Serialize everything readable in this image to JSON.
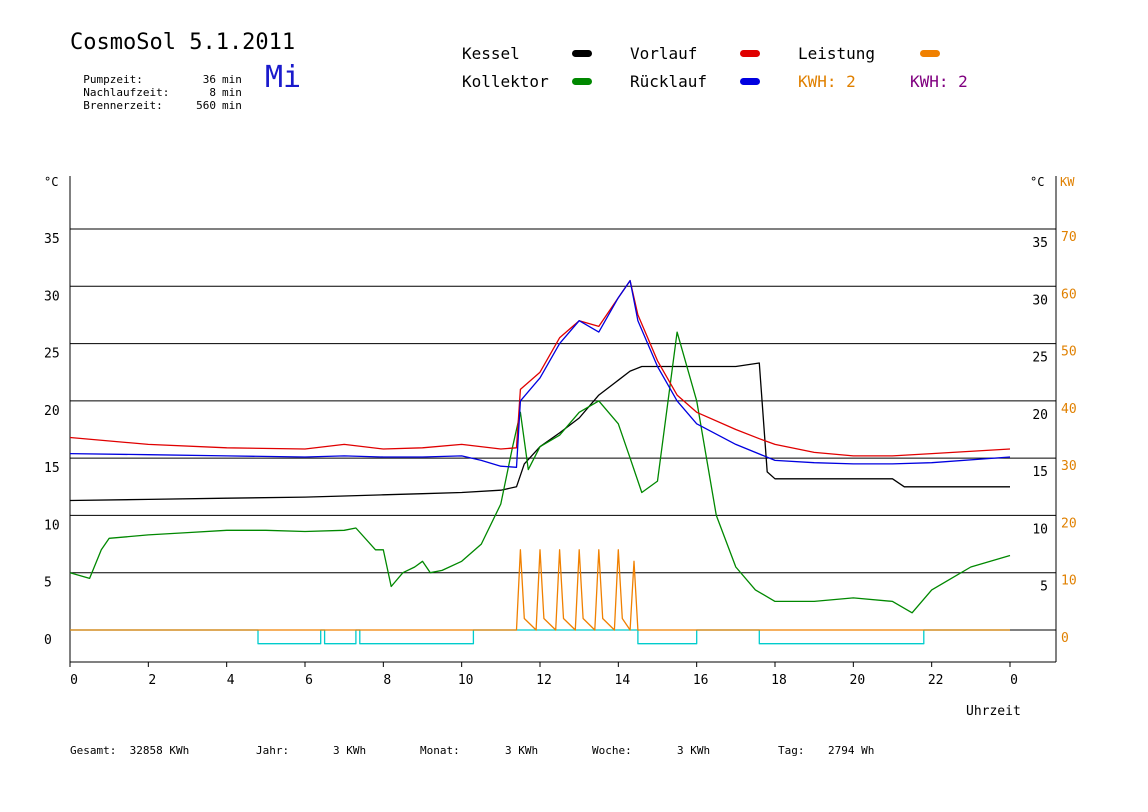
{
  "header": {
    "title": "CosmoSol 5.1.2011",
    "weekday": "Mi",
    "stats": [
      {
        "label": "Pumpzeit:",
        "value": "36",
        "unit": "min"
      },
      {
        "label": "Nachlaufzeit:",
        "value": "8",
        "unit": "min"
      },
      {
        "label": "Brennerzeit:",
        "value": "560",
        "unit": "min"
      }
    ]
  },
  "legend": {
    "kessel": "Kessel",
    "kollektor": "Kollektor",
    "vorlauf": "Vorlauf",
    "ruecklauf": "Rücklauf",
    "leistung": "Leistung",
    "kwh_orange": "KWH: 2",
    "kwh_purple": "KWH: 2",
    "colors": {
      "kessel": "#000000",
      "kollektor": "#008800",
      "vorlauf": "#e00000",
      "ruecklauf": "#0000e0",
      "leistung": "#f08000",
      "kwh_purple": "#800080",
      "pump": "#00cccc"
    }
  },
  "footer": {
    "gesamt_label": "Gesamt:",
    "gesamt_value": "32858 KWh",
    "jahr_label": "Jahr:",
    "jahr_value": "3 KWh",
    "monat_label": "Monat:",
    "monat_value": "3 KWh",
    "woche_label": "Woche:",
    "woche_value": "3 KWh",
    "tag_label": "Tag:",
    "tag_value": "2794 Wh"
  },
  "chart_data": {
    "type": "line",
    "title": "CosmoSol 5.1.2011",
    "xlabel": "Uhrzeit",
    "ylabel_left": "°C",
    "ylabel_right_1": "°C",
    "ylabel_right_2": "KW",
    "xlim": [
      0,
      24
    ],
    "ylim": [
      0,
      40
    ],
    "ylim_kw": [
      0,
      80
    ],
    "x_ticks": [
      "0",
      "2",
      "4",
      "6",
      "8",
      "10",
      "12",
      "14",
      "16",
      "18",
      "20",
      "22",
      "0"
    ],
    "y_ticks_left": [
      "0",
      "5",
      "10",
      "15",
      "20",
      "25",
      "30",
      "35"
    ],
    "y_ticks_right_c": [
      "5",
      "10",
      "15",
      "20",
      "25",
      "30",
      "35"
    ],
    "y_ticks_right_kw": [
      "0",
      "10",
      "20",
      "30",
      "40",
      "50",
      "60",
      "70"
    ],
    "grid": "horizontal",
    "series": [
      {
        "name": "Kessel",
        "color": "#000000",
        "x": [
          0,
          2,
          4,
          6,
          7,
          8,
          9,
          10,
          11,
          11.4,
          11.6,
          12,
          12.5,
          13,
          13.5,
          14,
          14.3,
          14.6,
          15,
          16,
          17,
          17.6,
          17.8,
          18,
          19,
          20,
          21,
          21.3,
          22,
          24
        ],
        "y": [
          11.3,
          11.4,
          11.5,
          11.6,
          11.7,
          11.8,
          11.9,
          12.0,
          12.2,
          12.5,
          14.5,
          16,
          17.2,
          18.5,
          20.5,
          21.8,
          22.6,
          23,
          23,
          23,
          23,
          23.3,
          13.8,
          13.2,
          13.2,
          13.2,
          13.2,
          12.5,
          12.5,
          12.5
        ]
      },
      {
        "name": "Vorlauf",
        "color": "#e00000",
        "x": [
          0,
          2,
          4,
          6,
          7,
          8,
          9,
          10,
          11,
          11.4,
          11.5,
          12,
          12.5,
          13,
          13.5,
          14,
          14.3,
          14.5,
          15,
          15.5,
          16,
          17,
          17.6,
          18,
          19,
          20,
          21,
          22,
          24
        ],
        "y": [
          16.8,
          16.2,
          15.9,
          15.8,
          16.2,
          15.8,
          15.9,
          16.2,
          15.8,
          15.9,
          21,
          22.5,
          25.5,
          27,
          26.5,
          29,
          30.5,
          27.5,
          23.5,
          20.5,
          19,
          17.5,
          16.7,
          16.2,
          15.5,
          15.2,
          15.2,
          15.4,
          15.8
        ]
      },
      {
        "name": "Rücklauf",
        "color": "#0000e0",
        "x": [
          0,
          2,
          4,
          6,
          7,
          8,
          9,
          10,
          10.5,
          11,
          11.4,
          11.5,
          12,
          12.5,
          13,
          13.5,
          14,
          14.3,
          14.5,
          15,
          15.5,
          16,
          17,
          18,
          19,
          20,
          21,
          22,
          24
        ],
        "y": [
          15.4,
          15.3,
          15.2,
          15.1,
          15.2,
          15.1,
          15.1,
          15.2,
          14.8,
          14.3,
          14.2,
          20,
          22,
          25,
          27,
          26,
          29,
          30.5,
          27,
          23,
          20,
          18,
          16.2,
          14.8,
          14.6,
          14.5,
          14.5,
          14.6,
          15.1
        ]
      },
      {
        "name": "Kollektor",
        "color": "#008800",
        "x": [
          0,
          0.5,
          0.8,
          1,
          2,
          3,
          4,
          5,
          6,
          7,
          7.3,
          7.8,
          8,
          8.2,
          8.5,
          8.8,
          9,
          9.2,
          9.5,
          10,
          10.5,
          11,
          11.3,
          11.5,
          11.7,
          12,
          12.5,
          13,
          13.5,
          14,
          14.3,
          14.6,
          15,
          15.5,
          16,
          16.5,
          17,
          17.5,
          18,
          19,
          20,
          21,
          21.5,
          22,
          22.5,
          23,
          23.5,
          24
        ],
        "y": [
          5,
          4.5,
          7,
          8,
          8.3,
          8.5,
          8.7,
          8.7,
          8.6,
          8.7,
          8.9,
          7,
          7,
          3.8,
          5,
          5.5,
          6,
          5,
          5.2,
          6,
          7.5,
          11,
          16,
          19,
          14,
          16,
          17,
          19,
          20,
          18,
          15,
          12,
          13,
          26,
          20,
          10,
          5.5,
          3.5,
          2.5,
          2.5,
          2.8,
          2.5,
          1.5,
          3.5,
          4.5,
          5.5,
          6,
          6.5
        ]
      },
      {
        "name": "Leistung",
        "color": "#f08000",
        "x": [
          0,
          11.4,
          11.5,
          11.6,
          11.9,
          12,
          12.1,
          12.4,
          12.5,
          12.6,
          12.9,
          13,
          13.1,
          13.4,
          13.5,
          13.6,
          13.9,
          14,
          14.1,
          14.3,
          14.4,
          14.5,
          24
        ],
        "y": [
          0,
          0,
          7,
          1,
          0,
          7,
          1,
          0,
          7,
          1,
          0,
          7,
          1,
          0,
          7,
          1,
          0,
          7,
          1,
          0,
          6,
          0,
          0
        ]
      },
      {
        "name": "Pumpe",
        "color": "#00cccc",
        "x": [
          0,
          4.8,
          4.8,
          6.4,
          6.4,
          6.5,
          6.5,
          7.3,
          7.3,
          7.4,
          7.4,
          10.3,
          10.3,
          14.5,
          14.5,
          16.0,
          16.0,
          17.6,
          17.6,
          21.8,
          21.8,
          24
        ],
        "y": [
          0,
          0,
          -1.2,
          -1.2,
          0,
          0,
          -1.2,
          -1.2,
          0,
          0,
          -1.2,
          -1.2,
          0,
          0,
          -1.2,
          -1.2,
          0,
          0,
          -1.2,
          -1.2,
          0,
          0
        ]
      }
    ]
  }
}
